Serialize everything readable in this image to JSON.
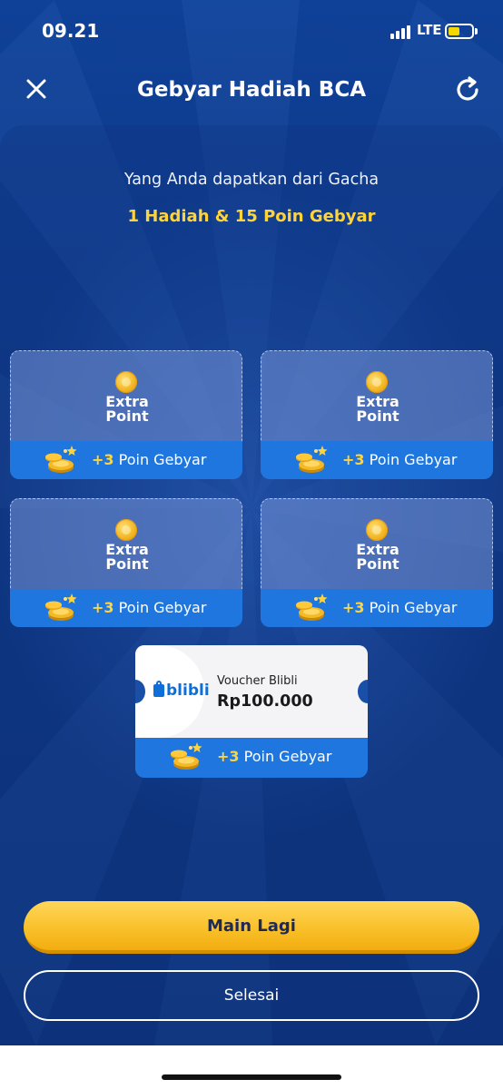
{
  "status_bar": {
    "time": "09.21",
    "network": "LTE",
    "icons": [
      "signal-icon",
      "battery-icon"
    ]
  },
  "header": {
    "title": "Gebyar Hadiah BCA",
    "close_icon": "close-icon",
    "refresh_icon": "refresh-icon"
  },
  "result": {
    "subtitle": "Yang Anda dapatkan dari Gacha",
    "summary": "1 Hadiah & 15 Poin Gebyar"
  },
  "cards": [
    {
      "line1": "Extra",
      "line2": "Point",
      "points_prefix": "+3",
      "points_suffix": " Poin Gebyar"
    },
    {
      "line1": "Extra",
      "line2": "Point",
      "points_prefix": "+3",
      "points_suffix": " Poin Gebyar"
    },
    {
      "line1": "Extra",
      "line2": "Point",
      "points_prefix": "+3",
      "points_suffix": " Poin Gebyar"
    },
    {
      "line1": "Extra",
      "line2": "Point",
      "points_prefix": "+3",
      "points_suffix": " Poin Gebyar"
    }
  ],
  "voucher": {
    "brand": "blibli",
    "name": "Voucher Blibli",
    "amount": "Rp100.000",
    "points_prefix": "+3",
    "points_suffix": " Poin Gebyar"
  },
  "buttons": {
    "primary": "Main Lagi",
    "secondary": "Selesai"
  },
  "colors": {
    "background": "#0e3a86",
    "accent_yellow": "#ffd43a",
    "card_footer_blue": "#1e76de",
    "button_yellow": "#f9c12b"
  }
}
